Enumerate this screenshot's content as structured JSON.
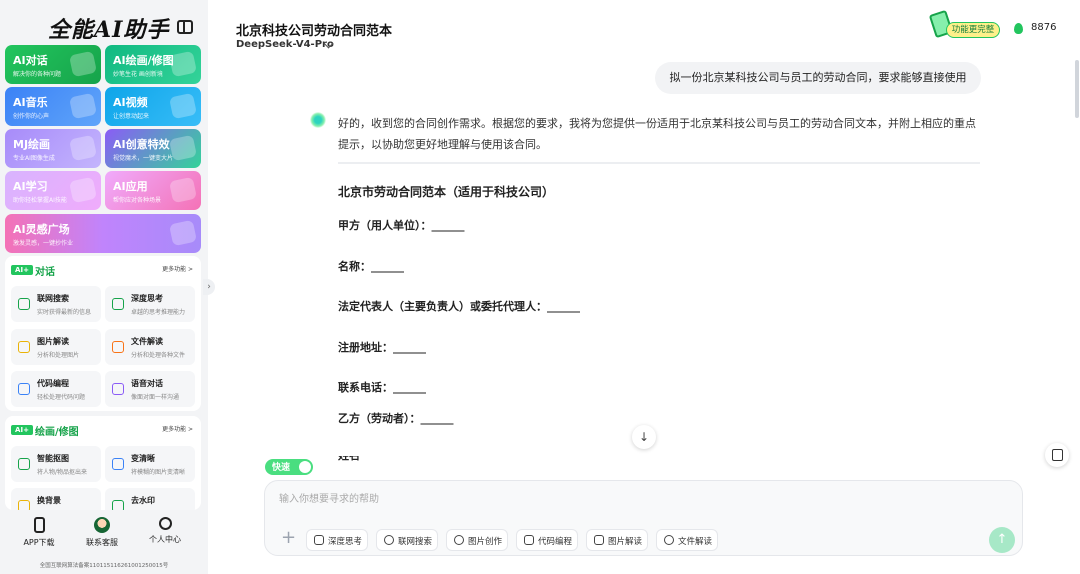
{
  "app": {
    "logo": "全能AI助手"
  },
  "sidebar": {
    "cards": [
      {
        "title": "AI对话",
        "subtitle": "解决你的各种问题"
      },
      {
        "title": "AI绘画/修图",
        "subtitle": "妙笔生花 画创新境"
      },
      {
        "title": "AI音乐",
        "subtitle": "创作你的心声"
      },
      {
        "title": "AI视频",
        "subtitle": "让创意动起来"
      },
      {
        "title": "MJ绘画",
        "subtitle": "专业AI图像生成"
      },
      {
        "title": "AI创意特效",
        "subtitle": "视觉魔术，一键变大片"
      },
      {
        "title": "AI学习",
        "subtitle": "助你轻松掌握AI技能"
      },
      {
        "title": "AI应用",
        "subtitle": "帮你应对各种场景"
      },
      {
        "title": "AI灵感广场",
        "subtitle": "激发灵感，一键抄作业"
      }
    ],
    "sections": [
      {
        "badge": "AI+",
        "title": "对话",
        "more": "更多功能 >",
        "tools": [
          {
            "name": "联网搜索",
            "desc": "实时获得最新的信息"
          },
          {
            "name": "深度思考",
            "desc": "卓越的思考推理能力"
          },
          {
            "name": "图片解读",
            "desc": "分析和处理图片"
          },
          {
            "name": "文件解读",
            "desc": "分析和处理各种文件"
          },
          {
            "name": "代码编程",
            "desc": "轻松处理代码问题"
          },
          {
            "name": "语音对话",
            "desc": "像面对面一样沟通"
          }
        ]
      },
      {
        "badge": "AI+",
        "title": "绘画/修图",
        "more": "更多功能 >",
        "tools": [
          {
            "name": "智能抠图",
            "desc": "将人物/物品抠出来"
          },
          {
            "name": "变清晰",
            "desc": "将模糊的图片变清晰"
          },
          {
            "name": "换背景",
            "desc": ""
          },
          {
            "name": "去水印",
            "desc": ""
          }
        ]
      }
    ],
    "bottom_nav": [
      {
        "label": "APP下载"
      },
      {
        "label": "联系客服"
      },
      {
        "label": "个人中心"
      }
    ],
    "icp": "全国互联网算法备案110115116261001250015号"
  },
  "header": {
    "title": "北京科技公司劳动合同范本",
    "model": "DeepSeek-V4-Pro",
    "upgrade_label": "功能更完整",
    "points": "8876"
  },
  "chat": {
    "user_message": "拟一份北京某科技公司与员工的劳动合同，要求能够直接使用",
    "reply_intro": "好的，收到您的合同创作需求。根据您的要求，我将为您提供一份适用于北京某科技公司与员工的劳动合同文本，并附上相应的重点提示，以协助您更好地理解与使用该合同。",
    "doc": {
      "title": "北京市劳动合同范本（适用于科技公司）",
      "lines": [
        "甲方（用人单位）：______",
        "名称：______",
        "法定代表人（主要负责人）或委托代理人：______",
        "注册地址：______",
        "联系电话：______",
        "乙方（劳动者）：______",
        "姓名"
      ]
    }
  },
  "composer": {
    "fast_label": "快速",
    "placeholder": "输入你想要寻求的帮助",
    "tools": [
      "深度思考",
      "联网搜索",
      "图片创作",
      "代码编程",
      "图片解读",
      "文件解读"
    ]
  },
  "colors": {
    "brand_green": "#22c55e",
    "sidebar_bg": "#f3f4f6",
    "bubble_bg": "#f2f3f5",
    "send_bg": "#a7e8c7"
  },
  "icons": {
    "collapse": "sidebar-collapse-icon",
    "expand": "chevron-down-icon",
    "points": "flame-icon",
    "scroll": "arrow-down-icon",
    "clear": "clear-icon",
    "plus": "plus-icon",
    "send": "arrow-up-icon"
  }
}
